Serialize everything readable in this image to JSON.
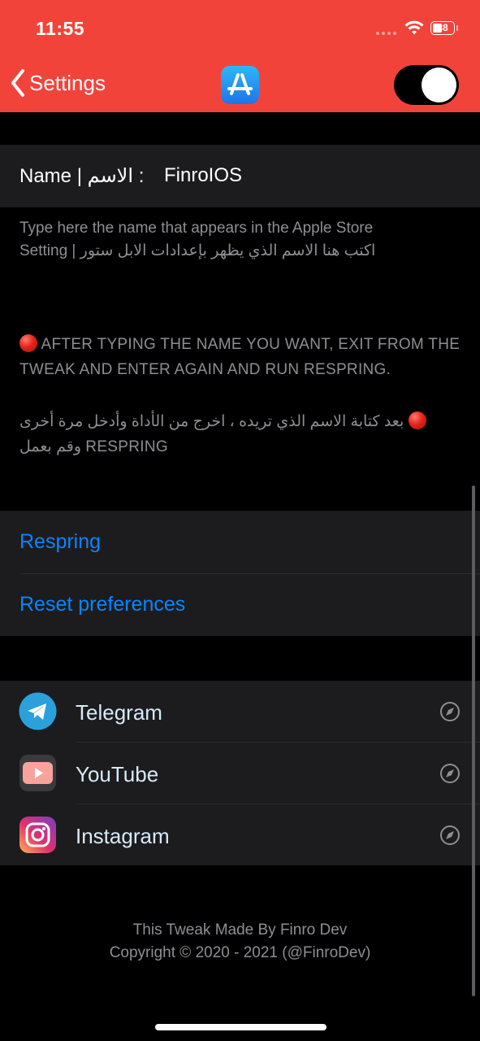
{
  "status_bar": {
    "time": "11:55",
    "battery": "38"
  },
  "nav": {
    "back_label": "Settings",
    "app_icon": "app-store-icon",
    "toggle_on": true
  },
  "name_setting": {
    "label": "Name | الاسم : ",
    "value": "FinroIOS"
  },
  "name_footer": {
    "line1": "Type here the name that appears in the Apple Store",
    "line2": "Setting | اكتب هنا الاسم الذي يظهر بإعدادات الابل ستور"
  },
  "notes": {
    "english": "AFTER TYPING THE NAME YOU WANT, EXIT FROM THE TWEAK AND ENTER AGAIN AND RUN RESPRING.",
    "arabic_line1": "بعد كتابة الاسم الذي تريده ، اخرج من الأداة وأدخل مرة أخرى",
    "arabic_line2": "وقم بعمل RESPRING"
  },
  "actions": {
    "respring": "Respring",
    "reset": "Reset preferences"
  },
  "links": [
    {
      "label": "Telegram",
      "icon": "telegram-icon"
    },
    {
      "label": "YouTube",
      "icon": "youtube-icon"
    },
    {
      "label": "Instagram",
      "icon": "instagram-icon"
    }
  ],
  "credits": {
    "line1": "This Tweak Made By Finro Dev",
    "line2": "Copyright © 2020 - 2021 (@FinroDev)"
  },
  "colors": {
    "header": "#f2433a",
    "link_blue": "#0a84ff",
    "cell_bg": "#1c1c1e"
  }
}
